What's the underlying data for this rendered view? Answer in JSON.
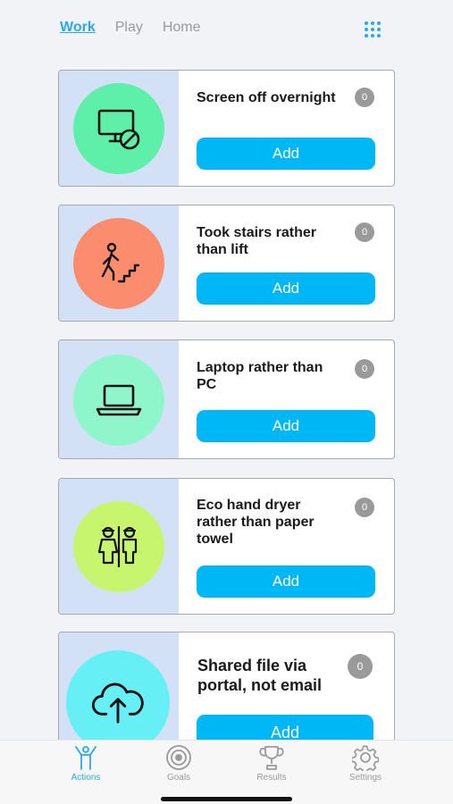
{
  "top_tabs": [
    {
      "label": "Work",
      "active": true
    },
    {
      "label": "Play",
      "active": false
    },
    {
      "label": "Home",
      "active": false
    }
  ],
  "grid_icon": "grid-icon",
  "cards": [
    {
      "title": "Screen off overnight",
      "count": "0",
      "button": "Add",
      "icon": "monitor-off-icon",
      "circle_color": "#5ef0a8"
    },
    {
      "title": "Took stairs rather than lift",
      "count": "0",
      "button": "Add",
      "icon": "stairs-icon",
      "circle_color": "#fb8c6d"
    },
    {
      "title": "Laptop rather than PC",
      "count": "0",
      "button": "Add",
      "icon": "laptop-icon",
      "circle_color": "#8ff5ca"
    },
    {
      "title": "Eco hand dryer rather than paper towel",
      "count": "0",
      "button": "Add",
      "icon": "restroom-icon",
      "circle_color": "#c8f56e"
    },
    {
      "title": "Shared file via portal, not email",
      "count": "0",
      "button": "Add",
      "icon": "cloud-upload-icon",
      "circle_color": "#66f0f5"
    }
  ],
  "bottom_nav": [
    {
      "label": "Actions",
      "icon": "actions-icon",
      "active": true
    },
    {
      "label": "Goals",
      "icon": "goals-icon",
      "active": false
    },
    {
      "label": "Results",
      "icon": "trophy-icon",
      "active": false
    },
    {
      "label": "Settings",
      "icon": "gear-icon",
      "active": false
    }
  ],
  "colors": {
    "accent": "#2aa9e8",
    "button": "#00b7f5",
    "panel": "#d3e1f7",
    "badge": "#9a9a9a"
  }
}
